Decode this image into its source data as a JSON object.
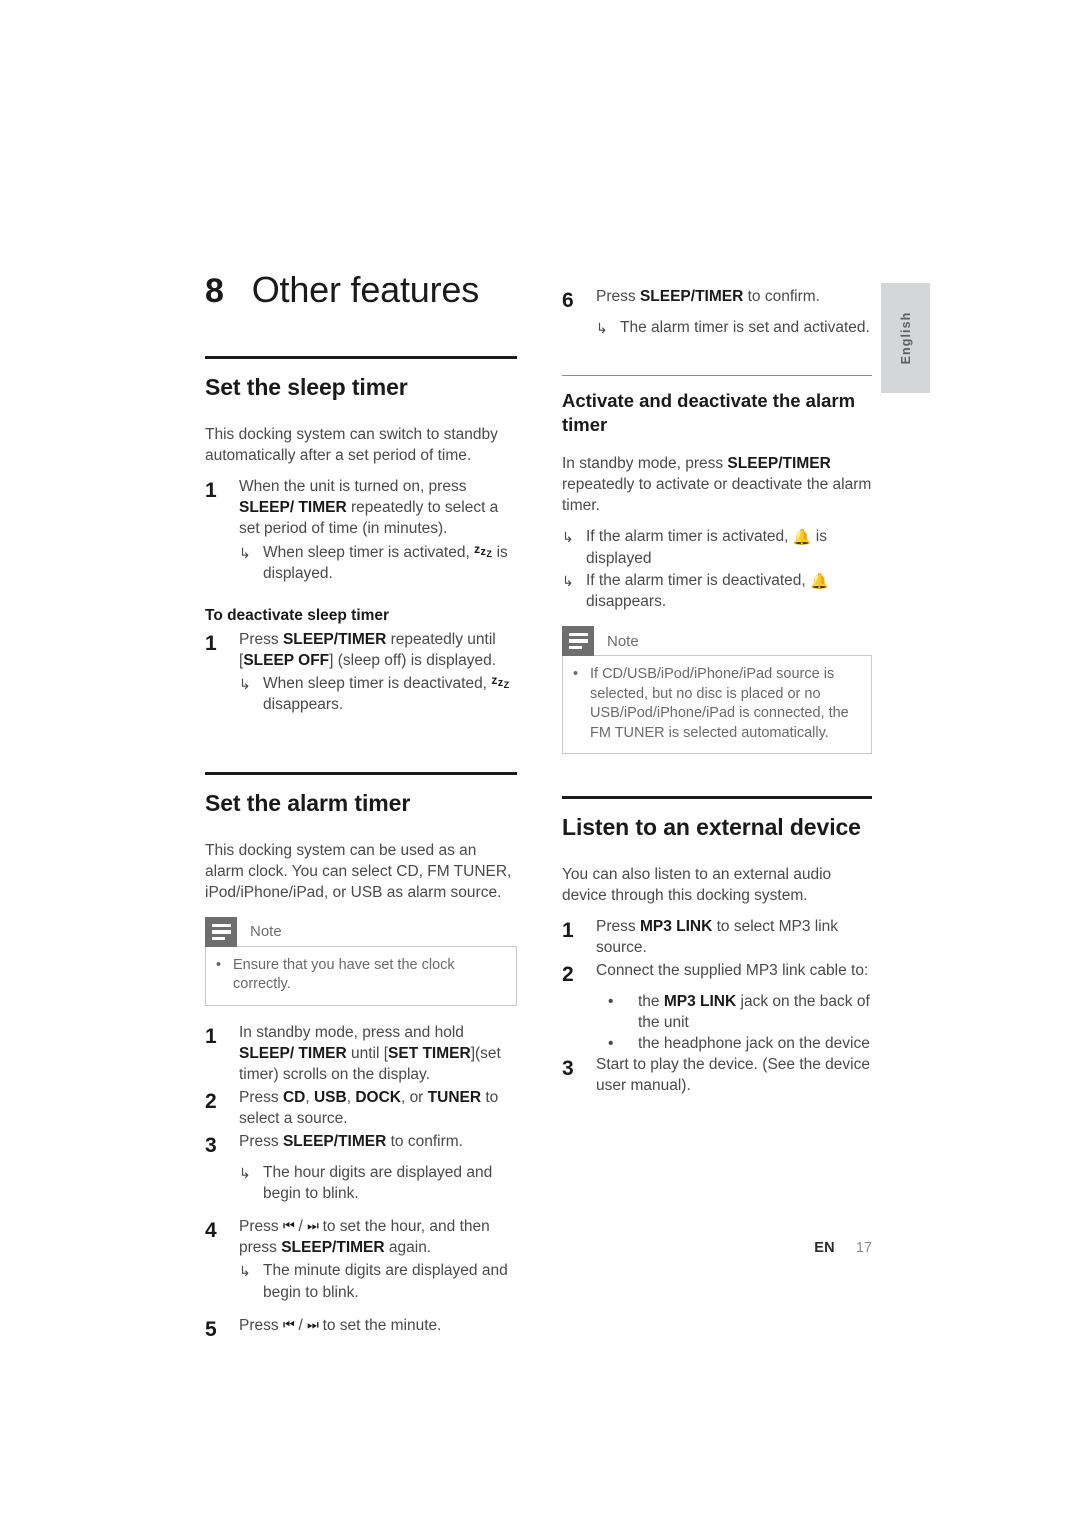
{
  "page": {
    "chapter_number": "8",
    "chapter_title": "Other features",
    "footer_lang": "EN",
    "footer_page": "17",
    "side_tab_label": "English"
  },
  "left_column": {
    "sleep_timer": {
      "heading": "Set the sleep timer",
      "intro": "This docking system can switch to standby automatically after a set period of time.",
      "step1_num": "1",
      "step1_pre": "When the unit is turned on, press ",
      "step1_bold1": "SLEEP/ TIMER",
      "step1_post": " repeatedly to select a set period of time (in minutes).",
      "arrow1_pre": "When sleep timer is activated, ",
      "arrow1_post": " is displayed.",
      "deactivate_heading": "To deactivate sleep timer",
      "d_step1_num": "1",
      "d_step1_pre": "Press ",
      "d_step1_bold1": "SLEEP/TIMER",
      "d_step1_mid": " repeatedly until [",
      "d_step1_bold2": "SLEEP OFF",
      "d_step1_post": "] (sleep off) is displayed.",
      "d_arrow1_pre": "When sleep timer is deactivated, ",
      "d_arrow1_post": " disappears."
    },
    "alarm_timer": {
      "heading": "Set the alarm timer",
      "intro": "This docking system can be used as an alarm clock. You can select CD, FM TUNER, iPod/iPhone/iPad, or USB as alarm source.",
      "note_title": "Note",
      "note_text": "Ensure that you have set the clock correctly.",
      "steps": [
        {
          "num": "1",
          "pre": "In standby mode, press and hold ",
          "bold1": "SLEEP/ TIMER",
          "mid": " until [",
          "bold2": "SET TIMER",
          "post": "](set timer) scrolls on the display."
        },
        {
          "num": "2",
          "pre": "Press ",
          "bold1": "CD",
          "sep1": ", ",
          "bold2": "USB",
          "sep2": ", ",
          "bold3": "DOCK",
          "sep3": ", or ",
          "bold4": "TUNER",
          "post": " to select a source."
        },
        {
          "num": "3",
          "pre": "Press ",
          "bold1": "SLEEP/TIMER",
          "post": " to confirm.",
          "arrow": "The hour digits are displayed and begin to blink."
        },
        {
          "num": "4",
          "pre": "Press ",
          "skip_prev": "⏮",
          "skip_sep": " / ",
          "skip_next": "⏭",
          "mid": " to set the hour, and then press ",
          "bold1": "SLEEP/TIMER",
          "post": " again.",
          "arrow": "The minute digits are displayed and begin to blink."
        },
        {
          "num": "5",
          "pre": "Press ",
          "skip_prev": "⏮",
          "skip_sep": " / ",
          "skip_next": "⏭",
          "post": " to set the minute."
        }
      ]
    }
  },
  "right_column": {
    "step6": {
      "num": "6",
      "pre": "Press ",
      "bold1": "SLEEP/TIMER",
      "post": " to confirm.",
      "arrow": "The alarm timer is set and activated."
    },
    "activate_deactivate": {
      "heading": "Activate and deactivate the alarm timer",
      "intro_pre": "In standby mode, press ",
      "intro_bold": "SLEEP/TIMER",
      "intro_post": " repeatedly to activate or deactivate the alarm timer.",
      "arrow1_pre": "If the alarm timer is activated, ",
      "arrow1_post": " is displayed",
      "arrow2_pre": "If the alarm timer is deactivated, ",
      "arrow2_post": " disappears.",
      "note_title": "Note",
      "note_text": "If CD/USB/iPod/iPhone/iPad source is selected, but no disc is placed or no USB/iPod/iPhone/iPad is connected, the FM TUNER is selected automatically."
    },
    "external_device": {
      "heading": "Listen to an external device",
      "intro": "You can also listen to an external audio device through this docking system.",
      "steps": [
        {
          "num": "1",
          "pre": "Press ",
          "bold1": "MP3 LINK",
          "post": " to select MP3 link source."
        },
        {
          "num": "2",
          "pre": "Connect the supplied MP3 link cable to:",
          "bullets": [
            {
              "pre": "the ",
              "bold": "MP3 LINK",
              "post": " jack on the back of the unit"
            },
            {
              "pre": "the headphone jack on the device",
              "bold": "",
              "post": ""
            }
          ]
        },
        {
          "num": "3",
          "pre": "Start to play the device. (See the device user manual)."
        }
      ]
    }
  },
  "icons": {
    "arrow": "↳",
    "bullet": "•",
    "bell": "🔔",
    "sleep_z": "zᶻ"
  }
}
